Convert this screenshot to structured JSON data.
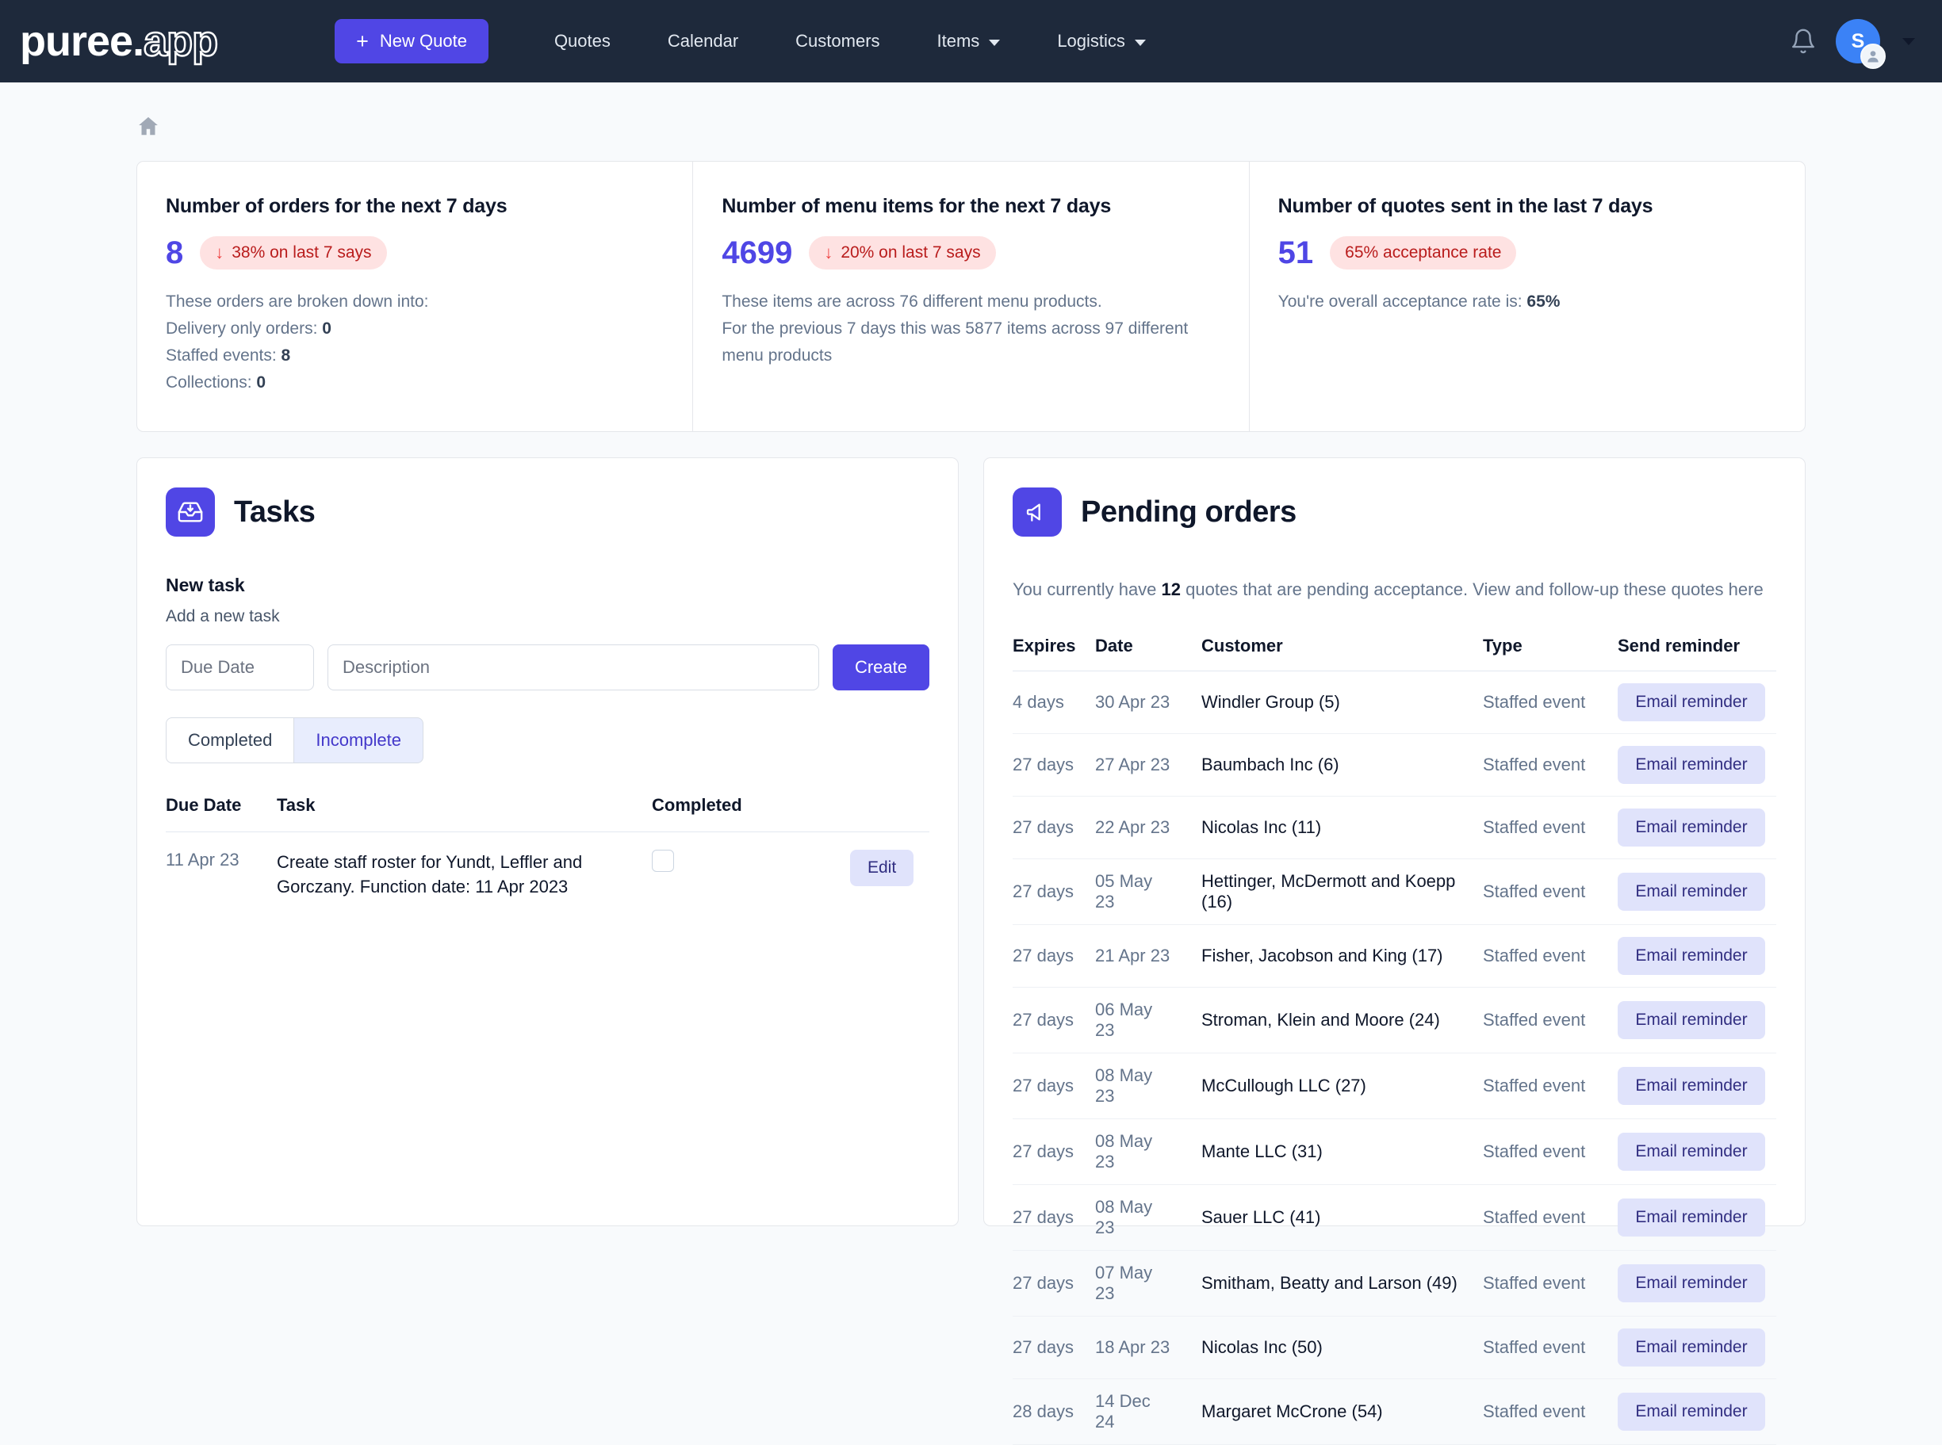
{
  "navbar": {
    "brand_solid": "puree",
    "brand_dot": ".",
    "brand_outline": "app",
    "new_quote_label": "New Quote",
    "plus": "+",
    "links": [
      {
        "label": "Quotes",
        "caret": false
      },
      {
        "label": "Calendar",
        "caret": false
      },
      {
        "label": "Customers",
        "caret": false
      },
      {
        "label": "Items",
        "caret": true
      },
      {
        "label": "Logistics",
        "caret": true
      }
    ],
    "avatar_initial": "S"
  },
  "stats": [
    {
      "title": "Number of orders for the next 7 days",
      "value": "8",
      "pill_arrow": "↓",
      "pill_text": "38% on last 7 says",
      "lines": [
        {
          "text": "These orders are broken down into:",
          "strong": ""
        },
        {
          "text": "Delivery only orders: ",
          "strong": "0"
        },
        {
          "text": "Staffed events: ",
          "strong": "8"
        },
        {
          "text": "Collections: ",
          "strong": "0"
        }
      ]
    },
    {
      "title": "Number of menu items for the next 7 days",
      "value": "4699",
      "pill_arrow": "↓",
      "pill_text": "20% on last 7 says",
      "lines": [
        {
          "text": "These items are across 76 different menu products.",
          "strong": ""
        },
        {
          "text": "For the previous 7 days this was 5877 items across 97 different menu products",
          "strong": ""
        }
      ]
    },
    {
      "title": "Number of quotes sent in the last 7 days",
      "value": "51",
      "pill_arrow": "",
      "pill_text": "65% acceptance rate",
      "lines": [
        {
          "text": "You're overall acceptance rate is: ",
          "strong": "65%"
        }
      ]
    }
  ],
  "tasks": {
    "title": "Tasks",
    "section_label": "New task",
    "section_sub": "Add a new task",
    "due_date_placeholder": "Due Date",
    "due_date_value": "",
    "description_placeholder": "Description",
    "description_value": "",
    "create_label": "Create",
    "filter_completed": "Completed",
    "filter_incomplete": "Incomplete",
    "active_filter": "Incomplete",
    "columns": [
      "Due Date",
      "Task",
      "Completed"
    ],
    "rows": [
      {
        "due_date": "11 Apr 23",
        "task": "Create staff roster for Yundt, Leffler and Gorczany. Function date: 11 Apr 2023",
        "completed": false,
        "edit_label": "Edit"
      }
    ]
  },
  "pending": {
    "title": "Pending orders",
    "subtitle_pre": "You currently have ",
    "subtitle_count": "12",
    "subtitle_post": " quotes that are pending acceptance. View and follow-up these quotes here",
    "columns": [
      "Expires",
      "Date",
      "Customer",
      "Type",
      "Send reminder"
    ],
    "reminder_label": "Email reminder",
    "rows": [
      {
        "expires": "4 days",
        "date": "30 Apr 23",
        "customer": "Windler Group (5)",
        "type": "Staffed event"
      },
      {
        "expires": "27 days",
        "date": "27 Apr 23",
        "customer": "Baumbach Inc (6)",
        "type": "Staffed event"
      },
      {
        "expires": "27 days",
        "date": "22 Apr 23",
        "customer": "Nicolas Inc (11)",
        "type": "Staffed event"
      },
      {
        "expires": "27 days",
        "date": "05 May 23",
        "customer": "Hettinger, McDermott and Koepp (16)",
        "type": "Staffed event"
      },
      {
        "expires": "27 days",
        "date": "21 Apr 23",
        "customer": "Fisher, Jacobson and King (17)",
        "type": "Staffed event"
      },
      {
        "expires": "27 days",
        "date": "06 May 23",
        "customer": "Stroman, Klein and Moore (24)",
        "type": "Staffed event"
      },
      {
        "expires": "27 days",
        "date": "08 May 23",
        "customer": "McCullough LLC (27)",
        "type": "Staffed event"
      },
      {
        "expires": "27 days",
        "date": "08 May 23",
        "customer": "Mante LLC (31)",
        "type": "Staffed event"
      },
      {
        "expires": "27 days",
        "date": "08 May 23",
        "customer": "Sauer LLC (41)",
        "type": "Staffed event"
      },
      {
        "expires": "27 days",
        "date": "07 May 23",
        "customer": "Smitham, Beatty and Larson (49)",
        "type": "Staffed event"
      },
      {
        "expires": "27 days",
        "date": "18 Apr 23",
        "customer": "Nicolas Inc (50)",
        "type": "Staffed event"
      },
      {
        "expires": "28 days",
        "date": "14 Dec 24",
        "customer": "Margaret McCrone (54)",
        "type": "Staffed event"
      }
    ]
  },
  "colors": {
    "navbar_bg": "#1e293b",
    "accent": "#5046e5",
    "accent_text": "#4f46e5",
    "pill_bg": "#fee2e2",
    "pill_text": "#b91c1c",
    "page_bg": "#f8fafc",
    "soft_indigo_bg": "#e0e3fb",
    "soft_indigo_text": "#312e81"
  },
  "icons": {
    "home": "home-icon",
    "bell": "bell-icon",
    "tasks": "inbox-download-icon",
    "pending": "megaphone-icon"
  }
}
